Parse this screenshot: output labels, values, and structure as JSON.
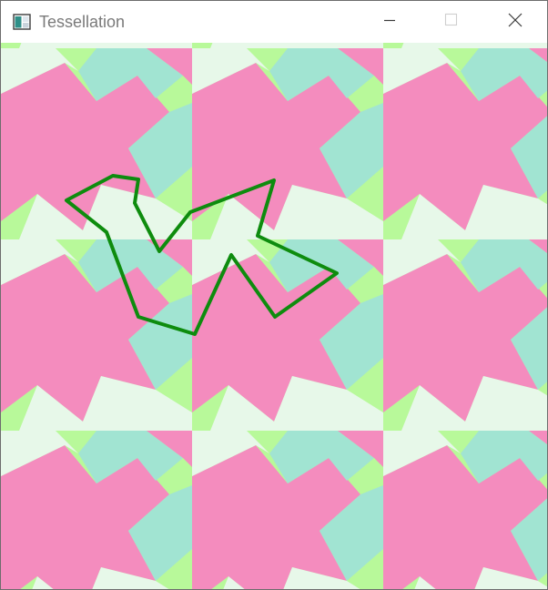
{
  "window": {
    "title": "Tessellation"
  },
  "title_controls": {
    "minimize_icon": "minimize-icon",
    "maximize_icon": "maximize-icon",
    "close_icon": "close-icon"
  },
  "tessellation": {
    "colors": {
      "pink": "#f48cbe",
      "teal": "#a1e4d2",
      "lime": "#b8f99a",
      "mint": "#e7f8e9"
    },
    "outline_color": "#0e8c0e"
  }
}
